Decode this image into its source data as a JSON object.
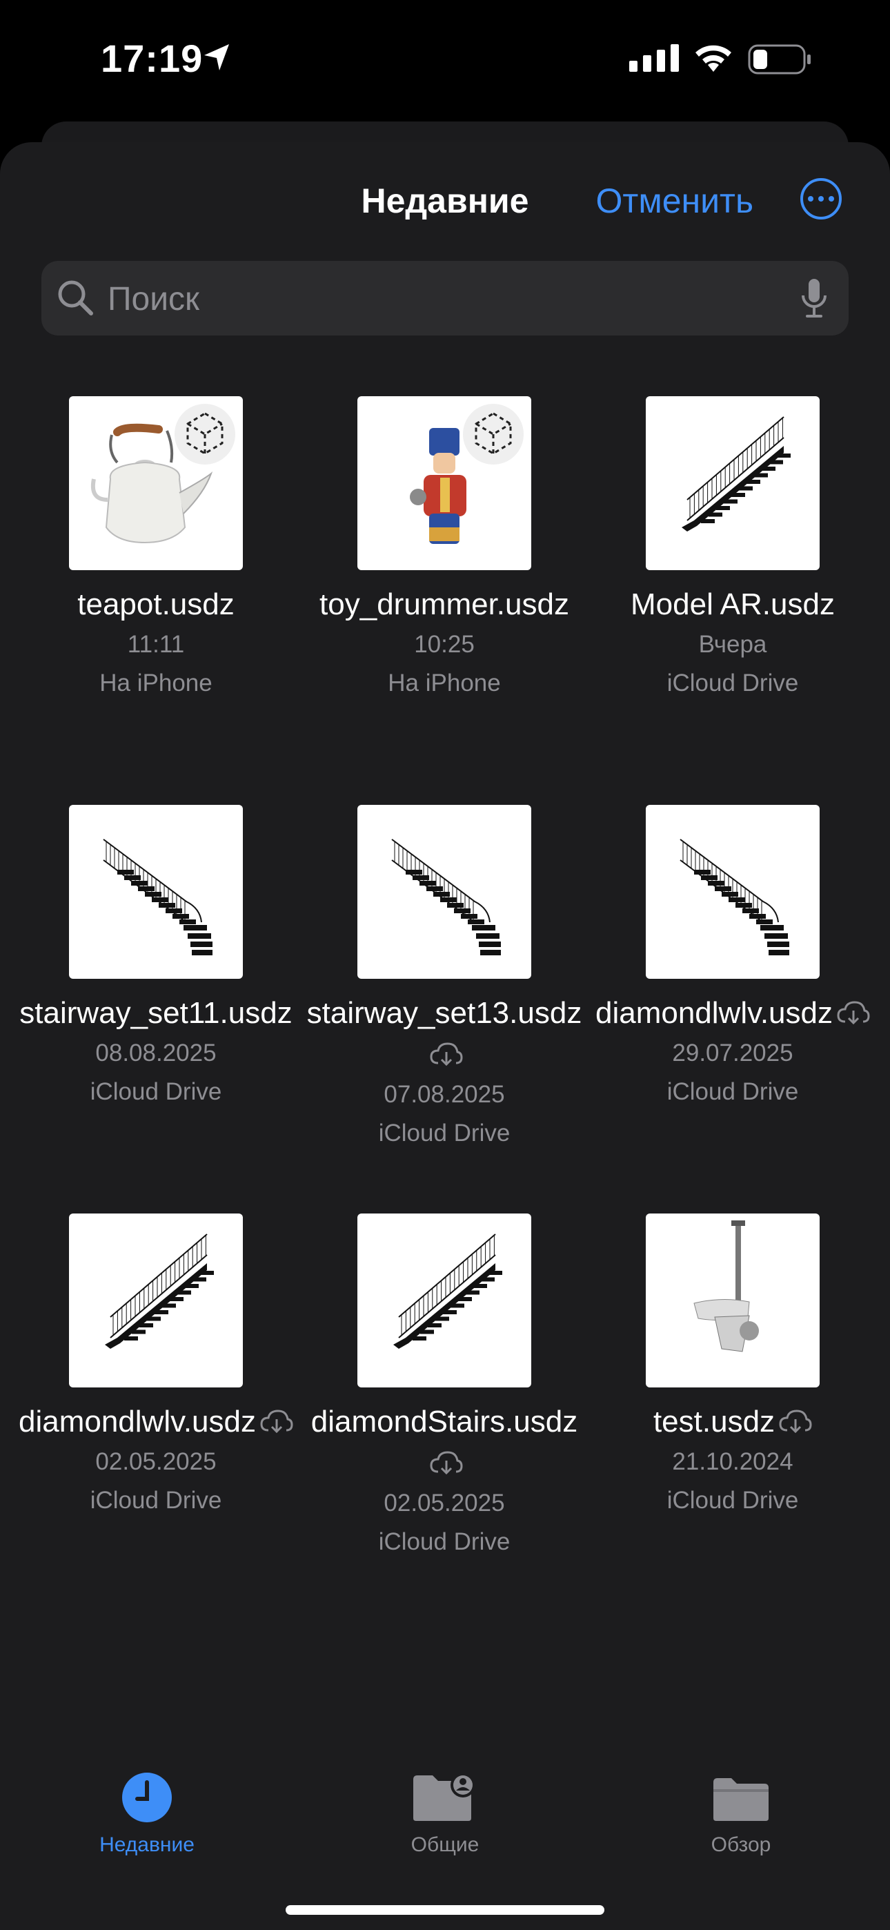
{
  "status_bar": {
    "time": "17:19",
    "battery_percent": 25
  },
  "header": {
    "title": "Недавние",
    "cancel_label": "Отменить",
    "more_icon": "ellipsis-circle-icon"
  },
  "search": {
    "placeholder": "Поиск",
    "value": ""
  },
  "files": [
    {
      "name": "teapot.usdz",
      "date": "11:11",
      "location": "На iPhone",
      "cloud": false,
      "thumb": "teapot",
      "ar_badge": true
    },
    {
      "name": "toy_drummer.usdz",
      "date": "10:25",
      "location": "На iPhone",
      "cloud": false,
      "thumb": "drummer",
      "ar_badge": true
    },
    {
      "name": "Model AR.usdz",
      "date": "Вчера",
      "location": "iCloud Drive",
      "cloud": false,
      "thumb": "stair-straight",
      "ar_badge": false
    },
    {
      "name": "stairway_set11.usdz",
      "date": "08.08.2025",
      "location": "iCloud Drive",
      "cloud": false,
      "thumb": "stair-curved",
      "ar_badge": false
    },
    {
      "name": "stairway_set13.usdz",
      "date": "07.08.2025",
      "location": "iCloud Drive",
      "cloud": true,
      "thumb": "stair-curved",
      "ar_badge": false
    },
    {
      "name": "diamondlwlv.usdz",
      "date": "29.07.2025",
      "location": "iCloud Drive",
      "cloud": true,
      "thumb": "stair-curved",
      "ar_badge": false
    },
    {
      "name": "diamondlwlv.usdz",
      "date": "02.05.2025",
      "location": "iCloud Drive",
      "cloud": true,
      "thumb": "stair-straight",
      "ar_badge": false
    },
    {
      "name": "diamondStairs.usdz",
      "date": "02.05.2025",
      "location": "iCloud Drive",
      "cloud": true,
      "thumb": "stair-straight",
      "ar_badge": false
    },
    {
      "name": "test.usdz",
      "date": "21.10.2024",
      "location": "iCloud Drive",
      "cloud": true,
      "thumb": "test-model",
      "ar_badge": false
    }
  ],
  "tabs": [
    {
      "label": "Недавние",
      "icon": "clock-icon",
      "active": true
    },
    {
      "label": "Общие",
      "icon": "shared-folder-icon",
      "active": false
    },
    {
      "label": "Обзор",
      "icon": "folder-icon",
      "active": false
    }
  ],
  "colors": {
    "accent": "#3e8ef7",
    "sheet": "#1c1c1e",
    "secondary_text": "#8e8e93"
  }
}
